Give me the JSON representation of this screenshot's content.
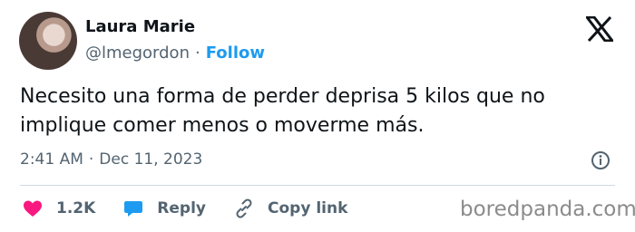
{
  "author": {
    "name": "Laura Marie",
    "handle": "@lmegordon",
    "follow_label": "Follow",
    "separator": "·"
  },
  "tweet": {
    "text": "Necesito una forma de perder deprisa 5 kilos que no implique comer menos o moverme más.",
    "time": "2:41 AM",
    "date": "Dec 11, 2023",
    "separator": "·"
  },
  "actions": {
    "likes_count": "1.2K",
    "reply_label": "Reply",
    "copy_link_label": "Copy link"
  },
  "watermark": "boredpanda.com",
  "icons": {
    "brand": "x-logo-icon",
    "info": "info-icon",
    "like": "heart-icon",
    "reply": "speech-bubble-icon",
    "copy": "link-icon"
  },
  "colors": {
    "accent": "#1d9bf0",
    "heart": "#f91880",
    "muted": "#536471"
  }
}
